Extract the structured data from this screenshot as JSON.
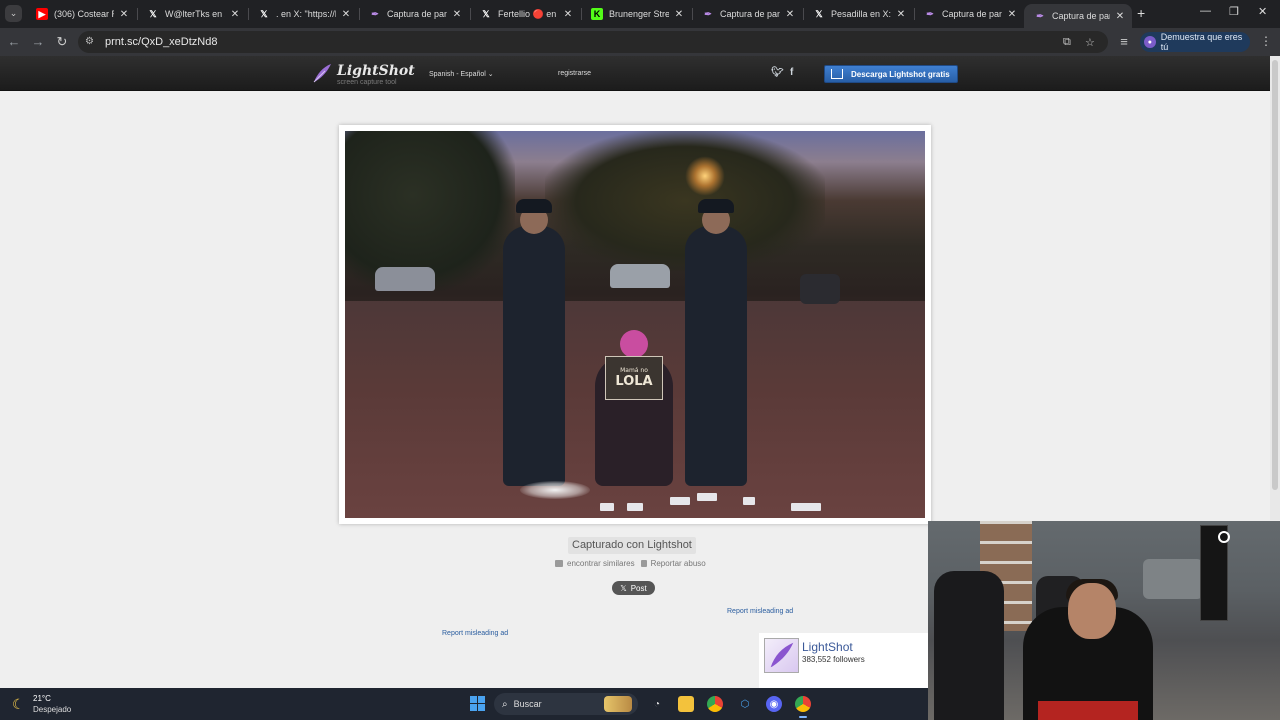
{
  "browser": {
    "tabs": [
      {
        "title": "(306) Costear Ren",
        "favicon": "youtube-icon",
        "active": false
      },
      {
        "title": "W@lterTks en X: \"",
        "favicon": "x-icon",
        "active": false
      },
      {
        "title": ". en X: \"https://Lo",
        "favicon": "x-icon",
        "active": false
      },
      {
        "title": "Captura de pantall",
        "favicon": "lightshot-icon",
        "active": false
      },
      {
        "title": "Fertellio 🔴 en X:",
        "favicon": "x-icon",
        "active": false
      },
      {
        "title": "Brunenger Stream",
        "favicon": "kick-icon",
        "active": false
      },
      {
        "title": "Captura de pantall",
        "favicon": "lightshot-icon",
        "active": false
      },
      {
        "title": "Pesadilla en X: \"ht",
        "favicon": "x-icon",
        "active": false
      },
      {
        "title": "Captura de pantall",
        "favicon": "lightshot-icon",
        "active": false
      },
      {
        "title": "Captura de pantall",
        "favicon": "lightshot-icon",
        "active": true
      }
    ],
    "url": "prnt.sc/QxD_xeDtzNd8",
    "profile_label": "Demuestra que eres tú"
  },
  "lightshot": {
    "brand": "LightShot",
    "tagline": "screen capture tool",
    "language": "Spanish - Español",
    "register": "registrarse",
    "download_button": "Descarga Lightshot gratis",
    "captured_with": "Capturado con Lightshot",
    "find_similar": "encontrar similares",
    "report_abuse": "Reportar abuso",
    "post_button": "Post",
    "report_ad_right": "Report misleading ad",
    "report_ad_left": "Report misleading ad",
    "photo": {
      "sign_line1": "Mamá no",
      "sign_line2": "LOLA"
    },
    "fb_widget": {
      "name": "LightShot",
      "followers": "383,552 followers"
    }
  },
  "taskbar": {
    "temperature": "21°C",
    "condition": "Despejado",
    "search_placeholder": "Buscar"
  },
  "colors": {
    "accent_blue": "#2a5d9f",
    "download_button": "#3f7fd0",
    "taskbar_bg": "#1f2530"
  }
}
